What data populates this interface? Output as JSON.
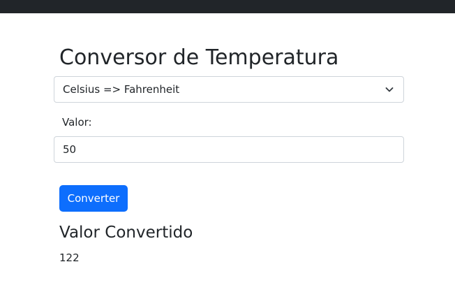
{
  "page": {
    "title": "Conversor de Temperatura"
  },
  "form": {
    "conversion_select": {
      "selected": "Celsius => Fahrenheit"
    },
    "value_label": "Valor:",
    "value_input": "50",
    "convert_button": "Converter"
  },
  "result": {
    "title": "Valor Convertido",
    "value": "122"
  },
  "colors": {
    "topbar": "#212529",
    "primary": "#0d6efd",
    "border": "#ced4da",
    "text": "#212529"
  },
  "icons": {
    "select_arrow": "chevron-down-icon"
  }
}
